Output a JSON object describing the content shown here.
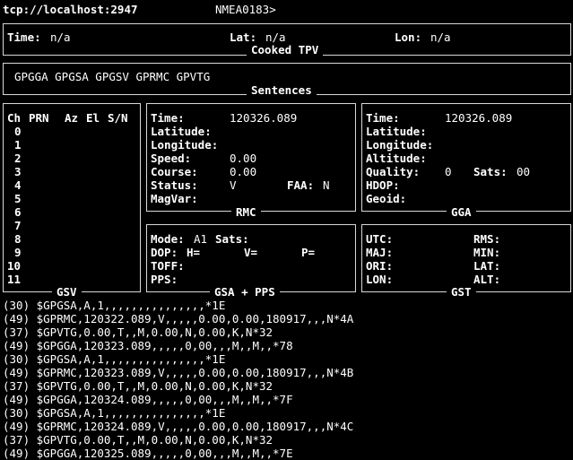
{
  "header": {
    "source": "tcp://localhost:2947",
    "protocol": "NMEA0183>"
  },
  "cooked": {
    "title": "Cooked TPV",
    "time_label": "Time:",
    "time_value": "n/a",
    "lat_label": "Lat:",
    "lat_value": "n/a",
    "lon_label": "Lon:",
    "lon_value": "n/a"
  },
  "sentences": {
    "title": "Sentences",
    "list": "GPGGA GPGSA GPGSV GPRMC GPVTG"
  },
  "gsv": {
    "title": "GSV",
    "headers": [
      "Ch",
      "PRN",
      "Az",
      "El",
      "S/N"
    ],
    "channels": [
      "0",
      "1",
      "2",
      "3",
      "4",
      "5",
      "6",
      "7",
      "8",
      "9",
      "10",
      "11"
    ]
  },
  "rmc": {
    "title": "RMC",
    "time_label": "Time:",
    "time_value": "120326.089",
    "lat_label": "Latitude:",
    "lon_label": "Longitude:",
    "speed_label": "Speed:",
    "speed_value": "0.00",
    "course_label": "Course:",
    "course_value": "0.00",
    "status_label": "Status:",
    "status_value": "V",
    "faa_label": "FAA:",
    "faa_value": "N",
    "magvar_label": "MagVar:"
  },
  "gga": {
    "title": "GGA",
    "time_label": "Time:",
    "time_value": "120326.089",
    "lat_label": "Latitude:",
    "lon_label": "Longitude:",
    "alt_label": "Altitude:",
    "quality_label": "Quality:",
    "quality_value": "0",
    "sats_label": "Sats:",
    "sats_value": "00",
    "hdop_label": "HDOP:",
    "geoid_label": "Geoid:"
  },
  "gsa": {
    "title": "GSA + PPS",
    "mode_label": "Mode:",
    "mode_value": "A1",
    "sats_label": "Sats:",
    "dop_label": "DOP:",
    "h_label": "H=",
    "v_label": "V=",
    "p_label": "P=",
    "toff_label": "TOFF:",
    "pps_label": "PPS:"
  },
  "gst": {
    "title": "GST",
    "utc_label": "UTC:",
    "rms_label": "RMS:",
    "maj_label": "MAJ:",
    "min_label": "MIN:",
    "ori_label": "ORI:",
    "lat_label": "LAT:",
    "lon_label": "LON:",
    "alt_label": "ALT:"
  },
  "log": [
    "(30) $GPGSA,A,1,,,,,,,,,,,,,,,*1E",
    "(49) $GPRMC,120322.089,V,,,,,0.00,0.00,180917,,,N*4A",
    "(37) $GPVTG,0.00,T,,M,0.00,N,0.00,K,N*32",
    "(49) $GPGGA,120323.089,,,,,0,00,,,M,,M,,*78",
    "(30) $GPGSA,A,1,,,,,,,,,,,,,,,*1E",
    "(49) $GPRMC,120323.089,V,,,,,0.00,0.00,180917,,,N*4B",
    "(37) $GPVTG,0.00,T,,M,0.00,N,0.00,K,N*32",
    "(49) $GPGGA,120324.089,,,,,0,00,,,M,,M,,*7F",
    "(30) $GPGSA,A,1,,,,,,,,,,,,,,,*1E",
    "(49) $GPRMC,120324.089,V,,,,,0.00,0.00,180917,,,N*4C",
    "(37) $GPVTG,0.00,T,,M,0.00,N,0.00,K,N*32",
    "(49) $GPGGA,120325.089,,,,,0,00,,,M,,M,,*7E"
  ]
}
